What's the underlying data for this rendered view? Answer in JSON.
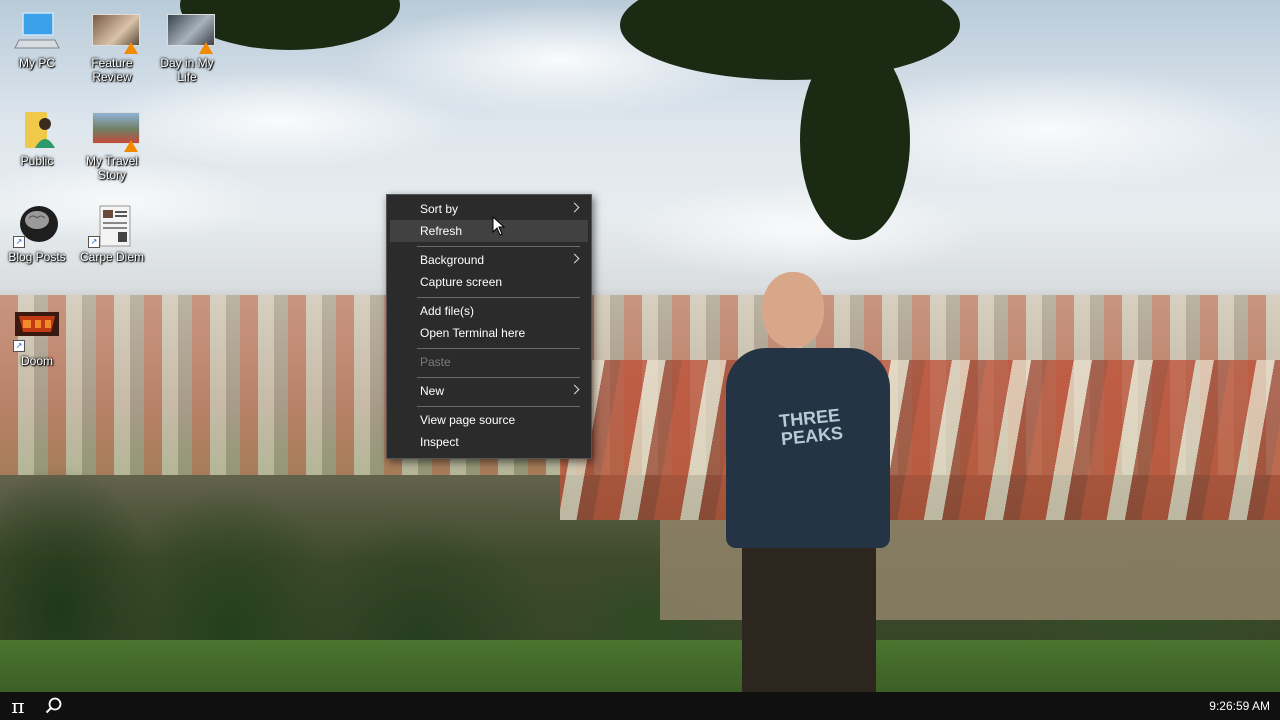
{
  "desktop": {
    "icons": [
      {
        "label": "My PC",
        "icon": "computer-icon"
      },
      {
        "label": "Feature Review",
        "icon": "video-file-icon"
      },
      {
        "label": "Day in My Life",
        "icon": "video-file-icon"
      },
      {
        "label": "Public",
        "icon": "user-folder-icon"
      },
      {
        "label": "My Travel Story",
        "icon": "video-file-icon"
      },
      {
        "label": "Blog Posts",
        "icon": "brain-shortcut-icon"
      },
      {
        "label": "Carpe Diem",
        "icon": "document-shortcut-icon"
      },
      {
        "label": "Doom",
        "icon": "doom-shortcut-icon"
      }
    ]
  },
  "wallpaper": {
    "shirt_text": "THREE PEAKS"
  },
  "context_menu": {
    "items": {
      "sort_by": "Sort by",
      "refresh": "Refresh",
      "background": "Background",
      "capture_screen": "Capture screen",
      "add_files": "Add file(s)",
      "open_terminal": "Open Terminal here",
      "paste": "Paste",
      "new": "New",
      "view_page_source": "View page source",
      "inspect": "Inspect"
    },
    "hovered": "refresh",
    "disabled": [
      "paste"
    ],
    "submenu_items": [
      "sort_by",
      "background",
      "new"
    ]
  },
  "taskbar": {
    "start_glyph": "π",
    "clock": "9:26:59 AM"
  },
  "colors": {
    "menu_bg": "#2b2b2b",
    "menu_hover": "#414141",
    "taskbar_bg": "#101010"
  }
}
